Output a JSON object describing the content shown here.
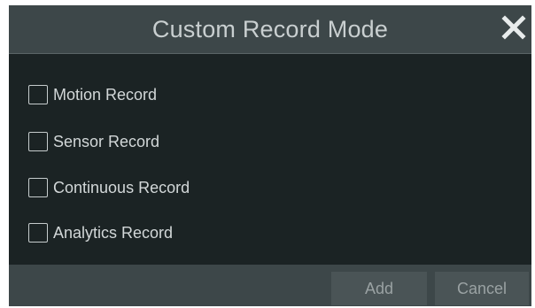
{
  "dialog": {
    "title": "Custom Record Mode",
    "close_icon": "close-icon"
  },
  "options": [
    {
      "label": "Motion Record",
      "checked": false
    },
    {
      "label": "Sensor Record",
      "checked": false
    },
    {
      "label": "Continuous Record",
      "checked": false
    },
    {
      "label": "Analytics Record",
      "checked": false
    }
  ],
  "footer": {
    "add_label": "Add",
    "cancel_label": "Cancel"
  },
  "colors": {
    "titlebar": "#3d4749",
    "body": "#1b2324",
    "text": "#d2d7d8",
    "button": "#4a5456"
  }
}
